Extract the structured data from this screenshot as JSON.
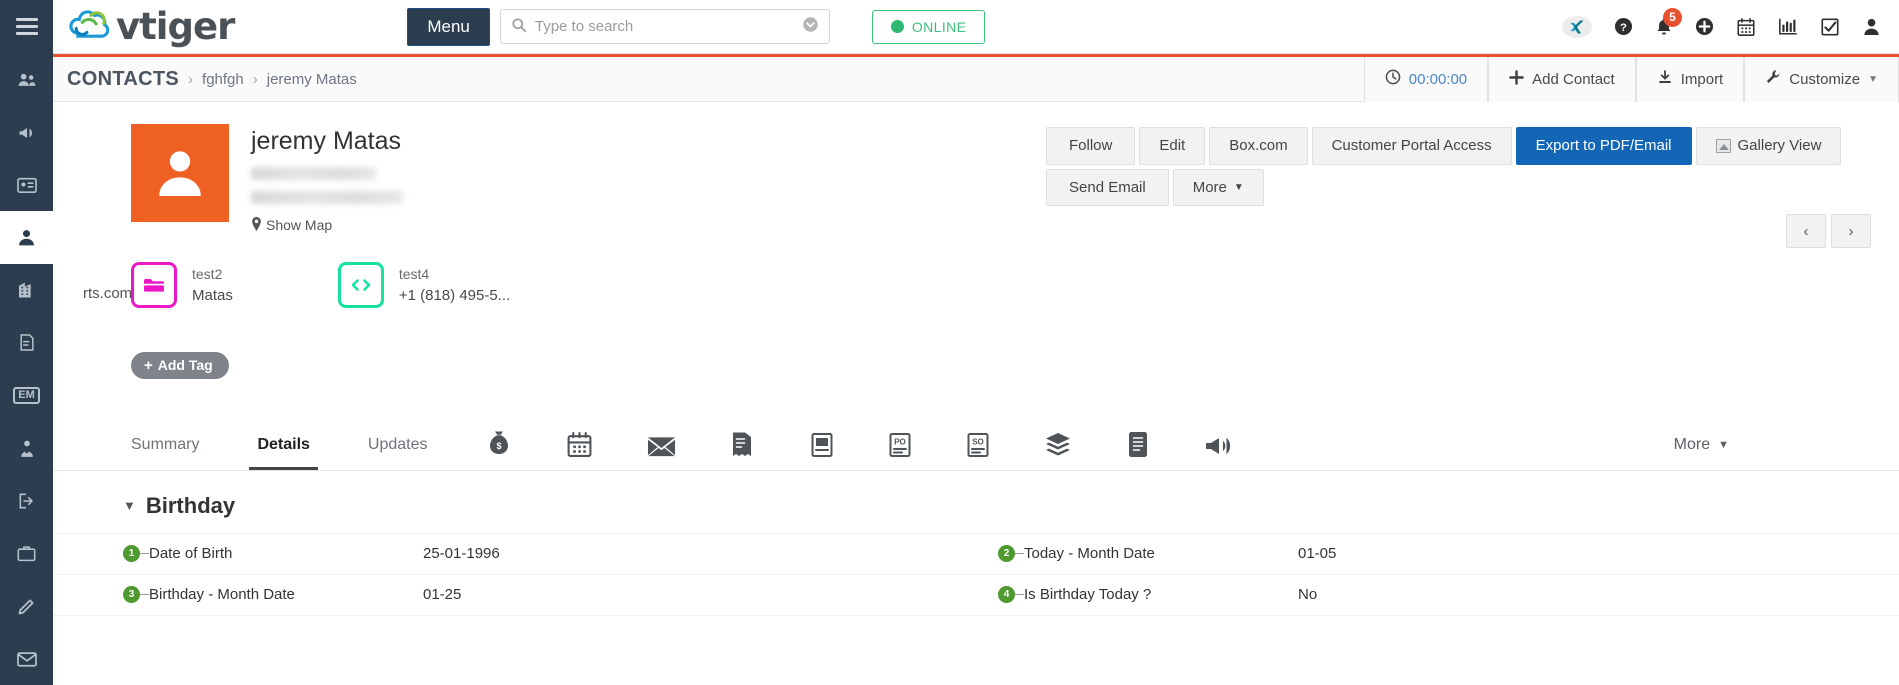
{
  "app": {
    "name": "vtiger"
  },
  "sidebar": {
    "items": [
      {
        "name": "sidebar-item-contacts-group",
        "icon": "users-icon",
        "active": false
      },
      {
        "name": "sidebar-item-campaigns",
        "icon": "megaphone-icon",
        "active": false
      },
      {
        "name": "sidebar-item-contact-card",
        "icon": "id-card-icon",
        "active": false
      },
      {
        "name": "sidebar-item-person",
        "icon": "person-icon",
        "active": true
      },
      {
        "name": "sidebar-item-organizations",
        "icon": "building-icon",
        "active": false
      },
      {
        "name": "sidebar-item-documents",
        "icon": "edit-document-icon",
        "active": false
      },
      {
        "name": "sidebar-item-em",
        "icon": "em-label-icon",
        "label": "EM",
        "active": false
      },
      {
        "name": "sidebar-item-vendors",
        "icon": "user-tie-icon",
        "active": false
      },
      {
        "name": "sidebar-item-exit",
        "icon": "sign-out-icon",
        "active": false
      },
      {
        "name": "sidebar-item-cases",
        "icon": "briefcase-icon",
        "active": false
      },
      {
        "name": "sidebar-item-pencil",
        "icon": "pencil-icon",
        "active": false
      },
      {
        "name": "sidebar-item-email",
        "icon": "envelope-icon",
        "active": false
      }
    ]
  },
  "topbar": {
    "menu_label": "Menu",
    "search": {
      "placeholder": "Type to search",
      "value": ""
    },
    "online_label": "ONLINE",
    "icons": [
      {
        "name": "xing-icon",
        "glyph": "✖"
      },
      {
        "name": "help-icon",
        "glyph": "?"
      },
      {
        "name": "notifications-bell-icon",
        "glyph": "🔔",
        "badge": "5"
      },
      {
        "name": "add-circle-icon",
        "glyph": "+"
      },
      {
        "name": "calendar-icon",
        "glyph": "📅"
      },
      {
        "name": "analytics-icon",
        "glyph": "📊"
      },
      {
        "name": "checkbox-icon",
        "glyph": "☑"
      },
      {
        "name": "user-account-icon",
        "glyph": "👤"
      }
    ]
  },
  "breadcrumb": {
    "root": "CONTACTS",
    "separator": "›",
    "items": [
      "fghfgh",
      "jeremy Matas"
    ]
  },
  "toolbar": {
    "timer_label": "00:00:00",
    "add_contact_label": "Add Contact",
    "import_label": "Import",
    "customize_label": "Customize"
  },
  "profile": {
    "name": "jeremy Matas",
    "phone_redacted": "",
    "email_redacted": "",
    "show_map_label": "Show Map",
    "cut_text": "rts.com"
  },
  "actions": {
    "row1": [
      {
        "label": "Follow",
        "primary": false
      },
      {
        "label": "Edit",
        "primary": false
      },
      {
        "label": "Box.com",
        "primary": false
      },
      {
        "label": "Customer Portal Access",
        "primary": false
      },
      {
        "label": "Export to PDF/Email",
        "primary": true
      },
      {
        "label": "Gallery View",
        "primary": false,
        "icon": "gallery-image-icon"
      }
    ],
    "row2": [
      {
        "label": "Send Email",
        "primary": false
      },
      {
        "label": "More",
        "primary": false,
        "caret": true
      }
    ],
    "prev_label": "‹",
    "next_label": "›"
  },
  "cards": [
    {
      "icon": "folder-icon",
      "color": "#ea18c7",
      "title": "test2",
      "subtitle": "Matas"
    },
    {
      "icon": "code-icon",
      "color": "#18e0a0",
      "title": "test4",
      "subtitle": "+1 (818) 495-5..."
    }
  ],
  "add_tag_label": "Add Tag",
  "tabs": [
    {
      "label": "Summary",
      "type": "text",
      "active": false,
      "name": "tab-summary"
    },
    {
      "label": "Details",
      "type": "text",
      "active": true,
      "name": "tab-details"
    },
    {
      "label": "Updates",
      "type": "text",
      "active": false,
      "name": "tab-updates"
    },
    {
      "label": "",
      "type": "icon",
      "icon": "money-bag-icon",
      "name": "tab-opportunities"
    },
    {
      "label": "",
      "type": "icon",
      "icon": "calendar-icon",
      "name": "tab-activities"
    },
    {
      "label": "",
      "type": "icon",
      "icon": "envelope-icon",
      "name": "tab-emails"
    },
    {
      "label": "",
      "type": "icon",
      "icon": "invoice-icon",
      "name": "tab-invoices"
    },
    {
      "label": "",
      "type": "icon",
      "icon": "quote-icon",
      "name": "tab-quotes"
    },
    {
      "label": "",
      "type": "icon",
      "icon": "purchase-order-icon",
      "name": "tab-purchase-orders"
    },
    {
      "label": "",
      "type": "icon",
      "icon": "sales-order-icon",
      "name": "tab-sales-orders"
    },
    {
      "label": "",
      "type": "icon",
      "icon": "products-icon",
      "name": "tab-products"
    },
    {
      "label": "",
      "type": "icon",
      "icon": "documents-icon",
      "name": "tab-documents"
    },
    {
      "label": "",
      "type": "icon",
      "icon": "campaigns-icon",
      "name": "tab-campaigns"
    }
  ],
  "tabs_more_label": "More",
  "details": {
    "section_title": "Birthday",
    "rows": [
      {
        "left": {
          "num": "1",
          "label": "Date of Birth",
          "value": "25-01-1996"
        },
        "right": {
          "num": "2",
          "label": "Today - Month Date",
          "value": "01-05"
        }
      },
      {
        "left": {
          "num": "3",
          "label": "Birthday - Month Date",
          "value": "01-25"
        },
        "right": {
          "num": "4",
          "label": "Is Birthday Today ?",
          "value": "No"
        }
      }
    ]
  },
  "colors": {
    "sidebar": "#2b3d4f",
    "accent": "#e8512f",
    "primary_button": "#1266b5",
    "avatar": "#ef6023",
    "online": "#3dc07c"
  }
}
